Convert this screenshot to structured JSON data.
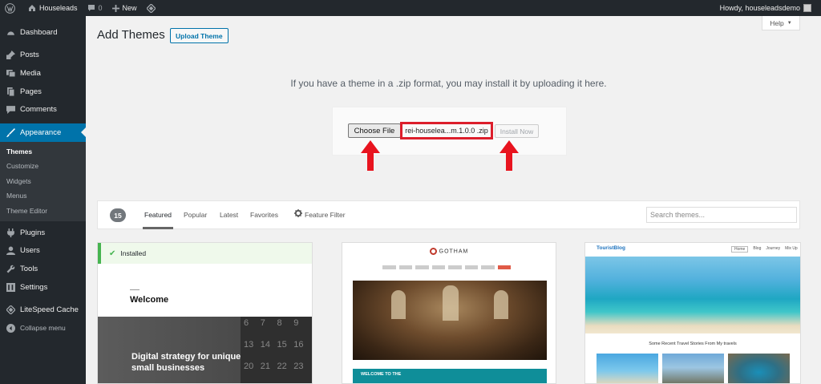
{
  "adminbar": {
    "site_name": "Houseleads",
    "comments_count": "0",
    "new_label": "New",
    "howdy": "Howdy, houseleadsdemo"
  },
  "sidebar": {
    "items": [
      {
        "label": "Dashboard",
        "icon": "dashboard-icon"
      },
      {
        "label": "Posts",
        "icon": "pin-icon"
      },
      {
        "label": "Media",
        "icon": "media-icon"
      },
      {
        "label": "Pages",
        "icon": "pages-icon"
      },
      {
        "label": "Comments",
        "icon": "comment-icon"
      },
      {
        "label": "Appearance",
        "icon": "brush-icon"
      },
      {
        "label": "Plugins",
        "icon": "plug-icon"
      },
      {
        "label": "Users",
        "icon": "user-icon"
      },
      {
        "label": "Tools",
        "icon": "wrench-icon"
      },
      {
        "label": "Settings",
        "icon": "settings-icon"
      },
      {
        "label": "LiteSpeed Cache",
        "icon": "litespeed-icon"
      },
      {
        "label": "Collapse menu",
        "icon": "collapse-icon"
      }
    ],
    "submenu": [
      "Themes",
      "Customize",
      "Widgets",
      "Menus",
      "Theme Editor"
    ]
  },
  "header": {
    "title": "Add Themes",
    "upload_label": "Upload Theme",
    "help_label": "Help"
  },
  "upload": {
    "message": "If you have a theme in a .zip format, you may install it by uploading it here.",
    "choose_label": "Choose File",
    "file_name": "rei-houselea...m.1.0.0 .zip",
    "install_label": "Install Now"
  },
  "filter": {
    "count": "15",
    "tabs": [
      "Featured",
      "Popular",
      "Latest",
      "Favorites"
    ],
    "feature_filter": "Feature Filter",
    "search_placeholder": "Search themes..."
  },
  "cards": {
    "installed_label": "Installed",
    "card1": {
      "welcome": "Welcome",
      "hero_text": "Digital strategy for unique small businesses",
      "calendar": [
        "6",
        "7",
        "8",
        "9",
        "13",
        "14",
        "15",
        "16",
        "20",
        "21",
        "22",
        "23"
      ]
    },
    "card2": {
      "logo": "GOTHAM",
      "banner": "WELCOME TO THE"
    },
    "card3": {
      "brand": "TouristBlog",
      "nav": [
        "Home",
        "Blog",
        "Journey",
        "Mix Up"
      ],
      "caption": "Some Recent Travel Stories From My travels"
    }
  },
  "colors": {
    "admin_dark": "#23282d",
    "accent_blue": "#0073aa",
    "highlight_red": "#dc1e2b",
    "success_green": "#46b450"
  }
}
